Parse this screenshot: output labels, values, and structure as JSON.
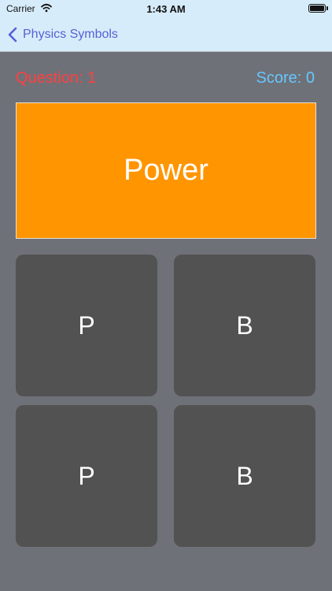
{
  "status_bar": {
    "carrier": "Carrier",
    "time": "1:43 AM",
    "wifi_icon": "wifi-icon",
    "battery_icon": "battery-icon",
    "battery_level": 1.0
  },
  "nav_bar": {
    "back_label": "Physics Symbols",
    "back_icon": "chevron-left-icon",
    "accent_color": "#5561D6"
  },
  "quiz": {
    "question_label": "Question: 1",
    "score_label": "Score: 0",
    "prompt": "Power",
    "prompt_color": "#FF9500",
    "question_color": "#FF4040",
    "score_color": "#65C7FF",
    "answers": [
      {
        "label": "P"
      },
      {
        "label": "B"
      },
      {
        "label": "P"
      },
      {
        "label": "B"
      }
    ]
  }
}
